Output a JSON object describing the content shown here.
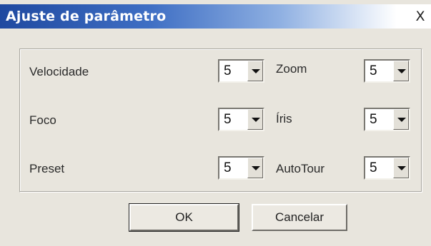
{
  "window": {
    "title": "Ajuste de parâmetro",
    "close_label": "X"
  },
  "parameters": {
    "velocidade": {
      "label": "Velocidade",
      "value": "5"
    },
    "zoom": {
      "label": "Zoom",
      "value": "5"
    },
    "foco": {
      "label": "Foco",
      "value": "5"
    },
    "iris": {
      "label": "Íris",
      "value": "5"
    },
    "preset": {
      "label": "Preset",
      "value": "5"
    },
    "autotour": {
      "label": "AutoTour",
      "value": "5"
    }
  },
  "buttons": {
    "ok_label": "OK",
    "cancel_label": "Cancelar"
  },
  "icons": {
    "close": "close-icon",
    "dropdown": "chevron-down-icon"
  }
}
